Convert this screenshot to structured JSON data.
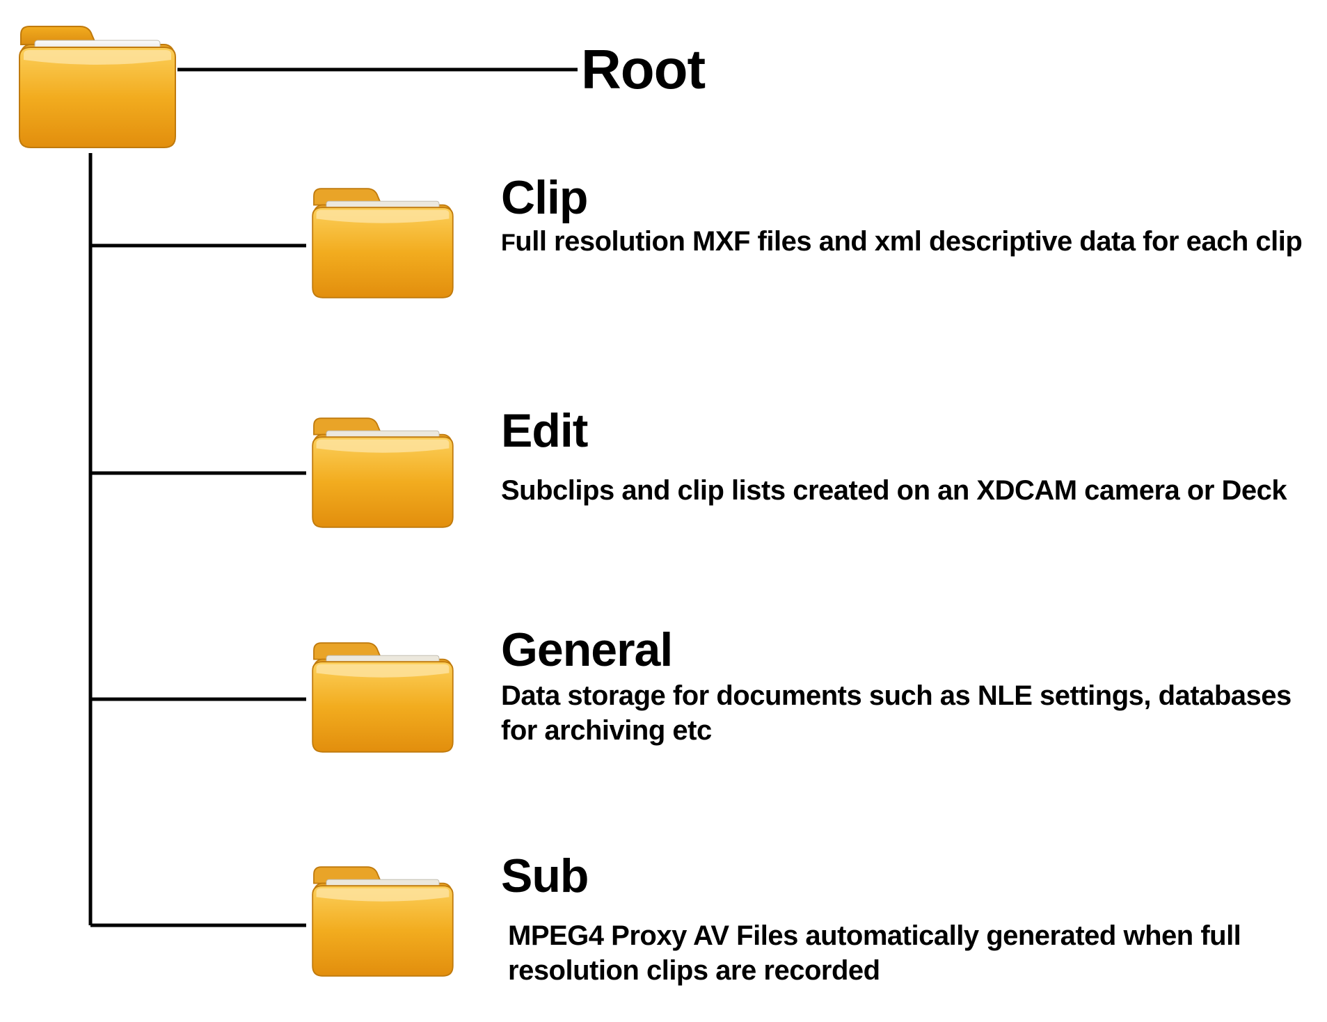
{
  "root": {
    "label": "Root"
  },
  "children": [
    {
      "name": "clip",
      "title": "Clip",
      "desc": "Full resolution MXF files and xml descriptive data for each clip"
    },
    {
      "name": "edit",
      "title": "Edit",
      "desc": "Subclips and clip lists created on an XDCAM camera or Deck"
    },
    {
      "name": "general",
      "title": "General",
      "desc": "Data storage for documents such as NLE settings, databases for archiving etc"
    },
    {
      "name": "sub",
      "title": "Sub",
      "desc": "MPEG4 Proxy AV Files automatically generated when full resolution clips are recorded"
    }
  ]
}
